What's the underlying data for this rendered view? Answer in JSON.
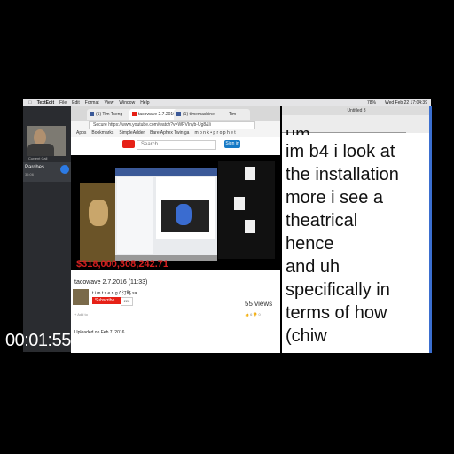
{
  "menubar": {
    "app": "TextEdit",
    "items": [
      "File",
      "Edit",
      "Format",
      "View",
      "Window",
      "Help"
    ],
    "clock": "Wed Feb 22 17:04:39",
    "battery": "78%"
  },
  "call": {
    "header": "Current Call",
    "caller_name": "Parches",
    "caller_time": "35:06"
  },
  "browser": {
    "tabs": [
      "(1) Tim Tseng",
      "tacowave 2.7.2016",
      "(1) timemachine",
      "Tim"
    ],
    "url": "Secure  https://www.youtube.com/watch?v=WPVInyb-Ug8&li",
    "bookmarks": [
      "Apps",
      "Bookmarks",
      "SimpleAdder",
      "Bare Aphex Twin ga",
      "m o n k • p r o p h e t"
    ],
    "search_placeholder": "Search",
    "signin": "Sign in"
  },
  "video": {
    "overlay_number": "$318,000,308,242.71",
    "title": "tacowave 2.7.2016 (11:33)",
    "channel": "t i m t s e n g /' 汀略 sa.",
    "subscribe": "Subscribe",
    "sub_count": "222",
    "views": "55 views",
    "add_to": "+  Add to",
    "uploaded": "Uploaded on Feb 7, 2016",
    "uploaded_sub": "11:33)"
  },
  "textedit": {
    "window_title": "Untitled 3",
    "top_partial": "um",
    "lines": [
      "im b4 i look at",
      "the installation",
      "more i see a",
      "theatrical",
      "hence",
      "and uh",
      "specifically in",
      "terms of how",
      "(chiw"
    ]
  },
  "timecode": "00:01:55;16"
}
